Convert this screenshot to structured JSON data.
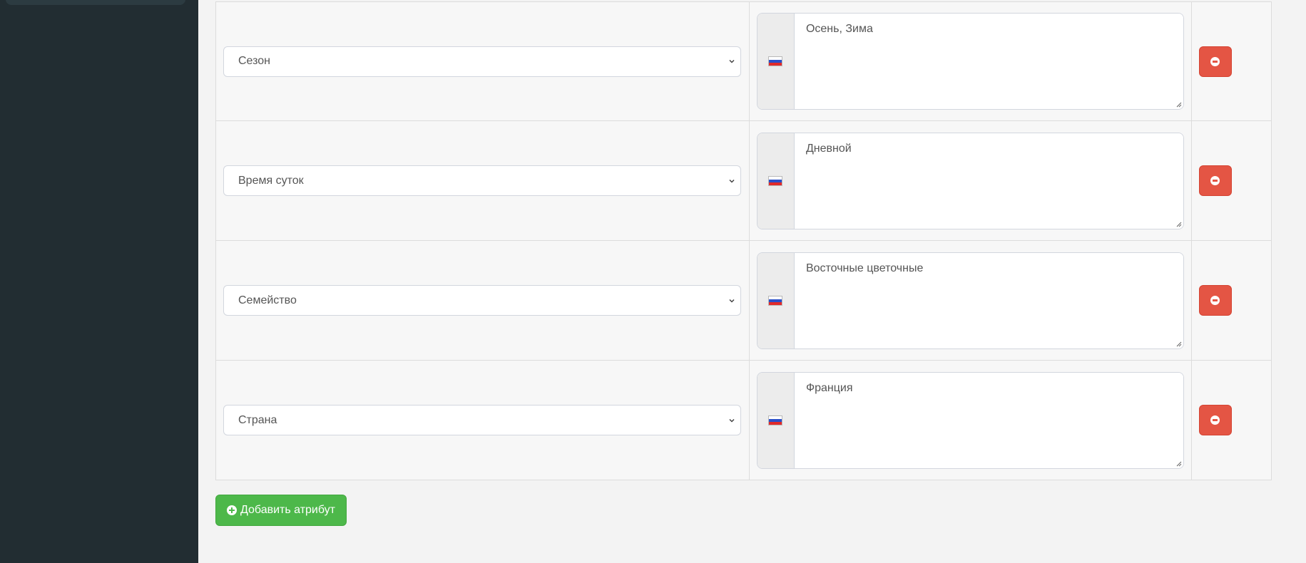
{
  "attributes": [
    {
      "attribute": "Сезон",
      "language_flag": "ru-flag-icon",
      "value": "Осень, Зима"
    },
    {
      "attribute": "Время суток",
      "language_flag": "ru-flag-icon",
      "value": "Дневной"
    },
    {
      "attribute": "Семейство",
      "language_flag": "ru-flag-icon",
      "value": "Восточные цветочные"
    },
    {
      "attribute": "Страна",
      "language_flag": "ru-flag-icon",
      "value": "Франция"
    }
  ],
  "add_button": {
    "label": "Добавить атрибут",
    "icon": "plus-circle-icon"
  },
  "remove_button_icon": "minus-circle-icon",
  "colors": {
    "sidebar": "#222d32",
    "remove_button": "#e45544",
    "add_button": "#4db84a",
    "content_bg": "#f3f3f3"
  }
}
